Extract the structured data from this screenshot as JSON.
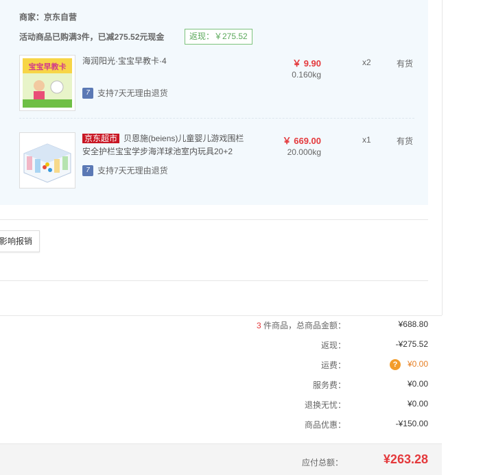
{
  "merchant": {
    "label": "商家：京东自营"
  },
  "promo": {
    "text": "活动商品已购满3件，已减275.52元现金",
    "badge": "返现：￥275.52"
  },
  "items": [
    {
      "title": "海润阳光·宝宝早教卡·4",
      "thumb_text": "宝宝早教卡",
      "service": "支持7天无理由退货",
      "price": "￥ 9.90",
      "weight": "0.160kg",
      "qty": "x2",
      "stock": "有货"
    },
    {
      "tag": "京东超市",
      "title": "贝恩施(beiens)儿童婴儿游戏围栏 安全护栏宝宝学步海洋球池室内玩具20+2",
      "service": "支持7天无理由退货",
      "price": "￥ 669.00",
      "weight": "20.000kg",
      "qty": "x1",
      "stock": "有货"
    }
  ],
  "reimburse": {
    "label": "影响报销"
  },
  "summary": {
    "count": "3",
    "count_suffix": " 件商品，总商品金额：",
    "goods_amount": "¥688.80",
    "cashback_label": "返现：",
    "cashback": "-¥275.52",
    "shipping_label": "运费：",
    "shipping": "¥0.00",
    "service_label": "服务费：",
    "service": "¥0.00",
    "return_label": "退换无忧：",
    "return_fee": "¥0.00",
    "discount_label": "商品优惠：",
    "discount": "-¥150.00",
    "total_label": "应付总额：",
    "total": "¥263.28"
  },
  "colors": {
    "accent": "#e4393c",
    "panel": "#f3f9fd",
    "badge_border": "#7cc27c",
    "tag_red": "#c81623"
  }
}
